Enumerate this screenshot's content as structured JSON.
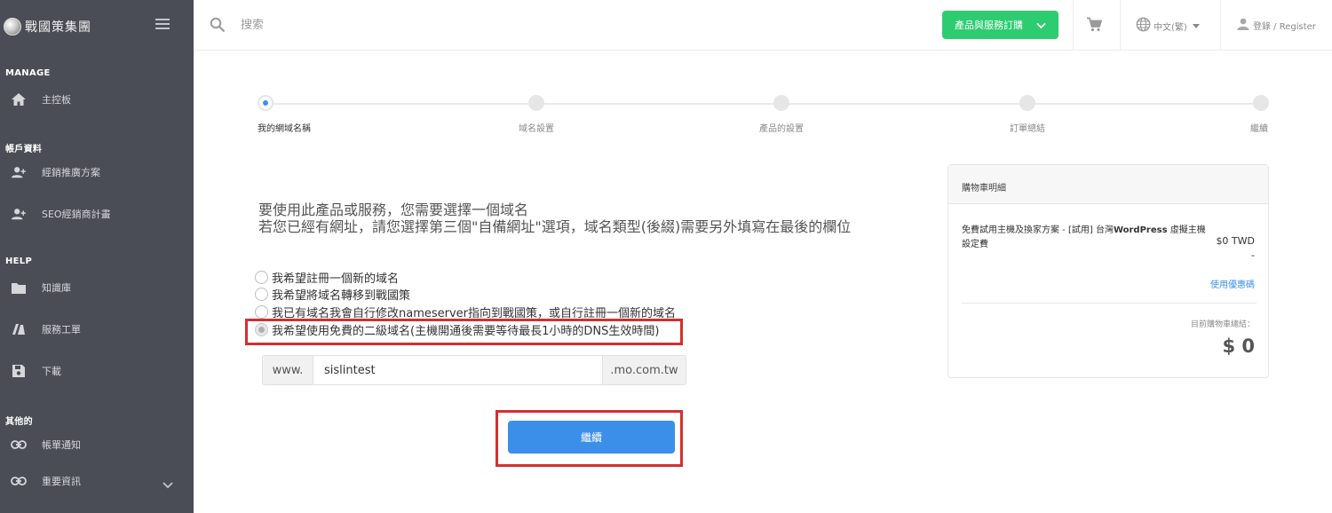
{
  "sidebar": {
    "logo_text": "戰國策集團",
    "sections": [
      {
        "label": "MANAGE",
        "items": [
          {
            "label": "主控板",
            "icon": "home-icon"
          }
        ]
      },
      {
        "label": "帳戶資料",
        "items": [
          {
            "label": "經銷推廣方案",
            "icon": "user-plus-icon"
          },
          {
            "label": "SEO經銷商計畫",
            "icon": "user-plus-icon"
          }
        ]
      },
      {
        "label": "HELP",
        "items": [
          {
            "label": "知識庫",
            "icon": "folder-icon"
          },
          {
            "label": "服務工單",
            "icon": "ticket-icon"
          },
          {
            "label": "下載",
            "icon": "save-icon"
          }
        ]
      },
      {
        "label": "其他的",
        "items": [
          {
            "label": "帳單通知",
            "icon": "link-icon"
          },
          {
            "label": "重要資訊",
            "icon": "link-icon"
          }
        ]
      }
    ]
  },
  "topbar": {
    "search_placeholder": "搜索",
    "order_button": "產品與服務訂購",
    "language": "中文(繁)",
    "login": "登錄 / Register"
  },
  "steps": [
    "我的網域名稱",
    "域名設置",
    "產品的設置",
    "訂單總結",
    "繼續"
  ],
  "main": {
    "heading1": "要使用此產品或服務，您需要選擇一個域名",
    "heading2": "若您已經有網址，請您選擇第三個\"自備網址\"選項，域名類型(後綴)需要另外填寫在最後的欄位",
    "options": [
      "我希望註冊一個新的域名",
      "我希望將域名轉移到戰國策",
      "我已有域名我會自行修改nameserver指向到戰國策，或自行註冊一個新的域名",
      "我希望使用免費的二級域名(主機開通後需要等待最長1小時的DNS生效時間)"
    ],
    "selected_option": 3,
    "domain_prefix": "www.",
    "domain_value": "sislintest",
    "domain_suffix": ".mo.com.tw",
    "continue_button": "繼續"
  },
  "cart": {
    "header": "購物車明細",
    "item_prefix": "免費試用主機及換家方案 - [試用] 台灣",
    "item_bold": "WordPress",
    "item_suffix": " 虛擬主機",
    "fee_label": "設定費",
    "fee_value": "$0 TWD",
    "fee_dash": "-",
    "promo_link": "使用優惠碼",
    "total_label": "目前購物車總結：",
    "total_value": "$ 0"
  },
  "colors": {
    "sidebar_bg": "#4a4d55",
    "order_green": "#2ecc71",
    "primary_blue": "#3b8fe8",
    "highlight_red": "#d32f2f"
  }
}
